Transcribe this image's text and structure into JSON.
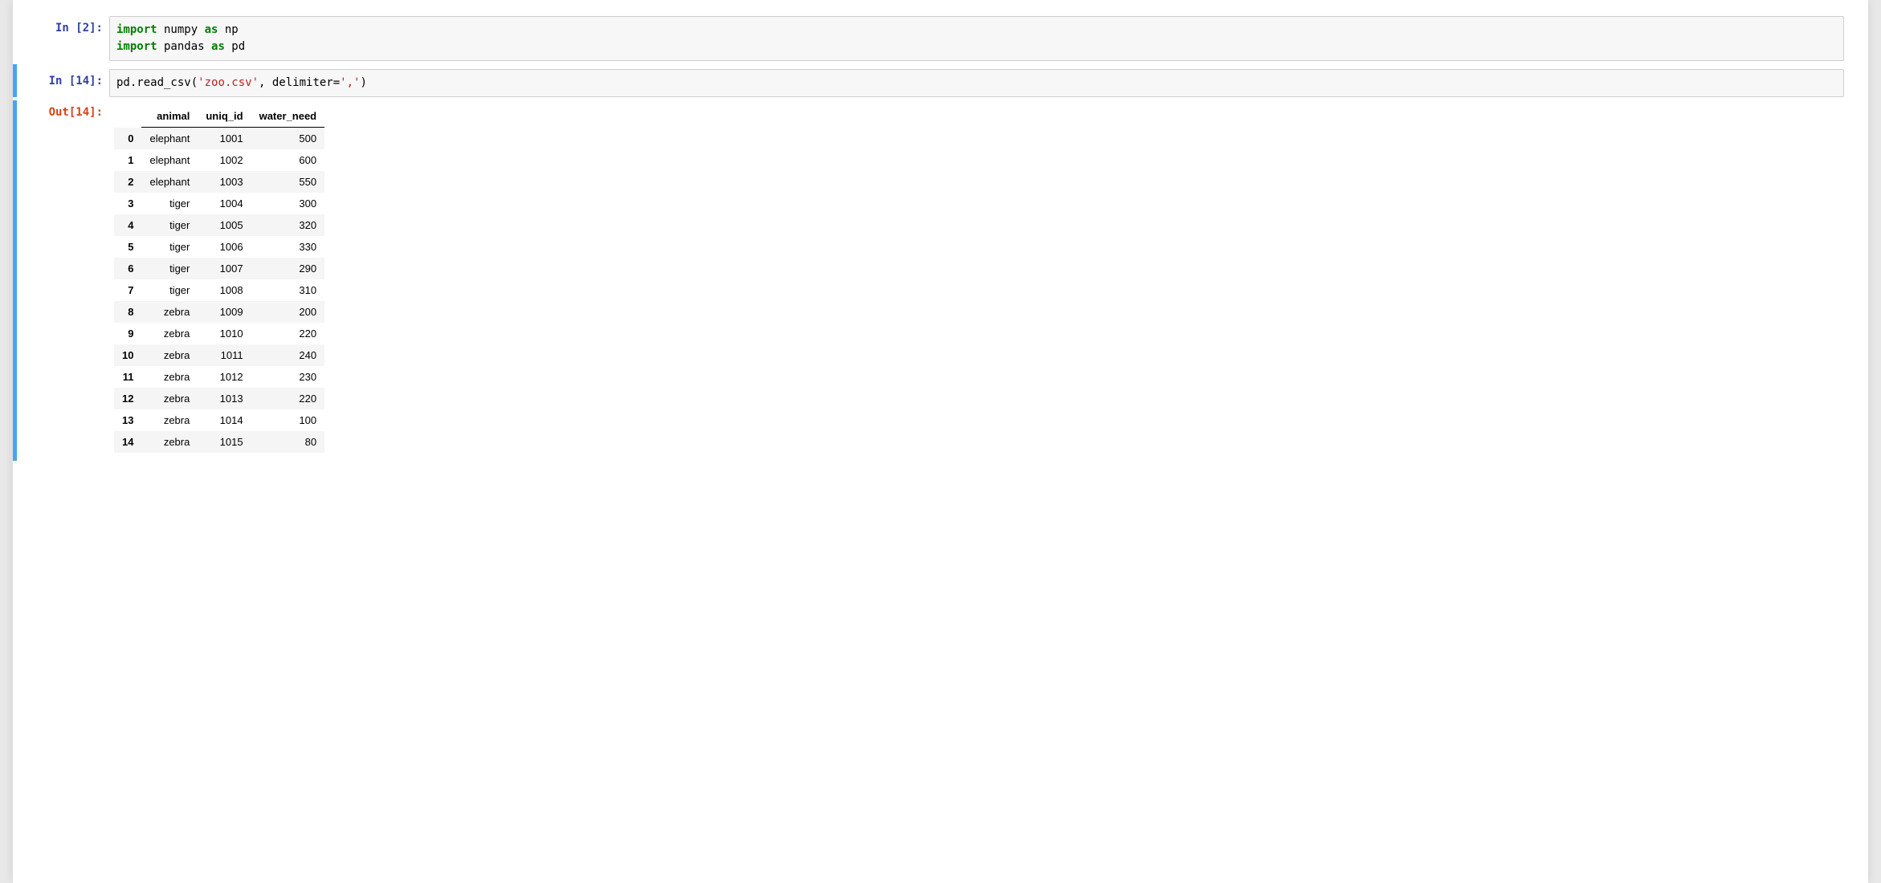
{
  "cells": {
    "cell1": {
      "prompt": "In [2]:",
      "code": {
        "line1_kw1": "import",
        "line1_mod": " numpy ",
        "line1_kw2": "as",
        "line1_alias": " np",
        "line2_kw1": "import",
        "line2_mod": " pandas ",
        "line2_kw2": "as",
        "line2_alias": " pd"
      }
    },
    "cell2": {
      "prompt_in": "In [14]:",
      "prompt_out": "Out[14]:",
      "code": {
        "prefix": "pd.read_csv(",
        "str1": "'zoo.csv'",
        "mid": ", delimiter=",
        "str2": "','",
        "suffix": ")"
      },
      "table": {
        "columns": [
          "animal",
          "uniq_id",
          "water_need"
        ],
        "rows": [
          {
            "idx": "0",
            "animal": "elephant",
            "uniq_id": "1001",
            "water_need": "500"
          },
          {
            "idx": "1",
            "animal": "elephant",
            "uniq_id": "1002",
            "water_need": "600"
          },
          {
            "idx": "2",
            "animal": "elephant",
            "uniq_id": "1003",
            "water_need": "550"
          },
          {
            "idx": "3",
            "animal": "tiger",
            "uniq_id": "1004",
            "water_need": "300"
          },
          {
            "idx": "4",
            "animal": "tiger",
            "uniq_id": "1005",
            "water_need": "320"
          },
          {
            "idx": "5",
            "animal": "tiger",
            "uniq_id": "1006",
            "water_need": "330"
          },
          {
            "idx": "6",
            "animal": "tiger",
            "uniq_id": "1007",
            "water_need": "290"
          },
          {
            "idx": "7",
            "animal": "tiger",
            "uniq_id": "1008",
            "water_need": "310"
          },
          {
            "idx": "8",
            "animal": "zebra",
            "uniq_id": "1009",
            "water_need": "200"
          },
          {
            "idx": "9",
            "animal": "zebra",
            "uniq_id": "1010",
            "water_need": "220"
          },
          {
            "idx": "10",
            "animal": "zebra",
            "uniq_id": "1011",
            "water_need": "240"
          },
          {
            "idx": "11",
            "animal": "zebra",
            "uniq_id": "1012",
            "water_need": "230"
          },
          {
            "idx": "12",
            "animal": "zebra",
            "uniq_id": "1013",
            "water_need": "220"
          },
          {
            "idx": "13",
            "animal": "zebra",
            "uniq_id": "1014",
            "water_need": "100"
          },
          {
            "idx": "14",
            "animal": "zebra",
            "uniq_id": "1015",
            "water_need": "80"
          }
        ]
      }
    }
  }
}
